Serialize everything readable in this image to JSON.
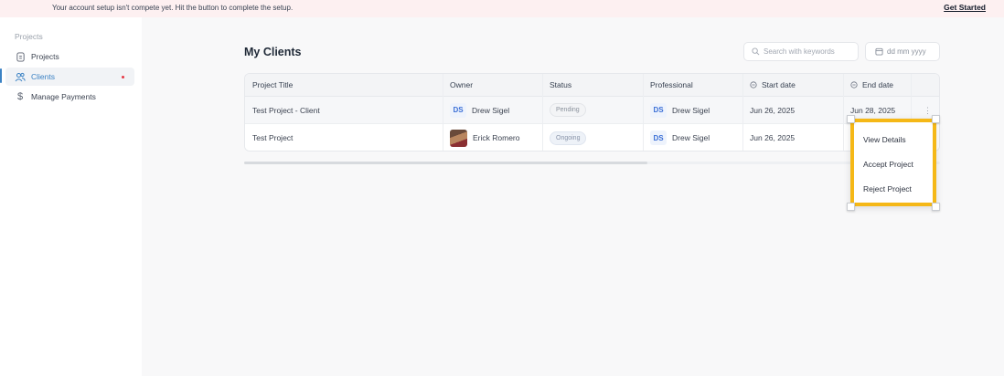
{
  "banner": {
    "message": "Your account setup isn't compete yet. Hit the button to complete the setup.",
    "cta": "Get Started"
  },
  "sidebar": {
    "section": "Projects",
    "items": [
      {
        "label": "Projects",
        "icon": "document-icon"
      },
      {
        "label": "Clients",
        "icon": "users-icon",
        "active": true,
        "dot": true
      },
      {
        "label": "Manage Payments",
        "icon": "dollar-icon"
      }
    ]
  },
  "main": {
    "title": "My Clients",
    "search_placeholder": "Search with keywords",
    "date_placeholder": "dd  mm  yyyy"
  },
  "table": {
    "headers": [
      "Project Title",
      "Owner",
      "Status",
      "Professional",
      "Start date",
      "End date"
    ],
    "rows": [
      {
        "title": "Test Project - Client",
        "owner_initials": "DS",
        "owner": "Drew Sigel",
        "status": "Pending",
        "pro_initials": "DS",
        "professional": "Drew Sigel",
        "start": "Jun 26, 2025",
        "end": "Jun 28, 2025"
      },
      {
        "title": "Test Project",
        "owner": "Erick Romero",
        "status": "Ongoing",
        "pro_initials": "DS",
        "professional": "Drew Sigel",
        "start": "Jun 26, 2025"
      }
    ],
    "kebab": "⋮"
  },
  "menu": {
    "items": [
      "View Details",
      "Accept Project",
      "Reject Project"
    ]
  },
  "colors": {
    "accent": "#3b82c4",
    "highlight": "#f5b817",
    "banner_bg": "#fdf0f1",
    "dot": "#e53945"
  }
}
